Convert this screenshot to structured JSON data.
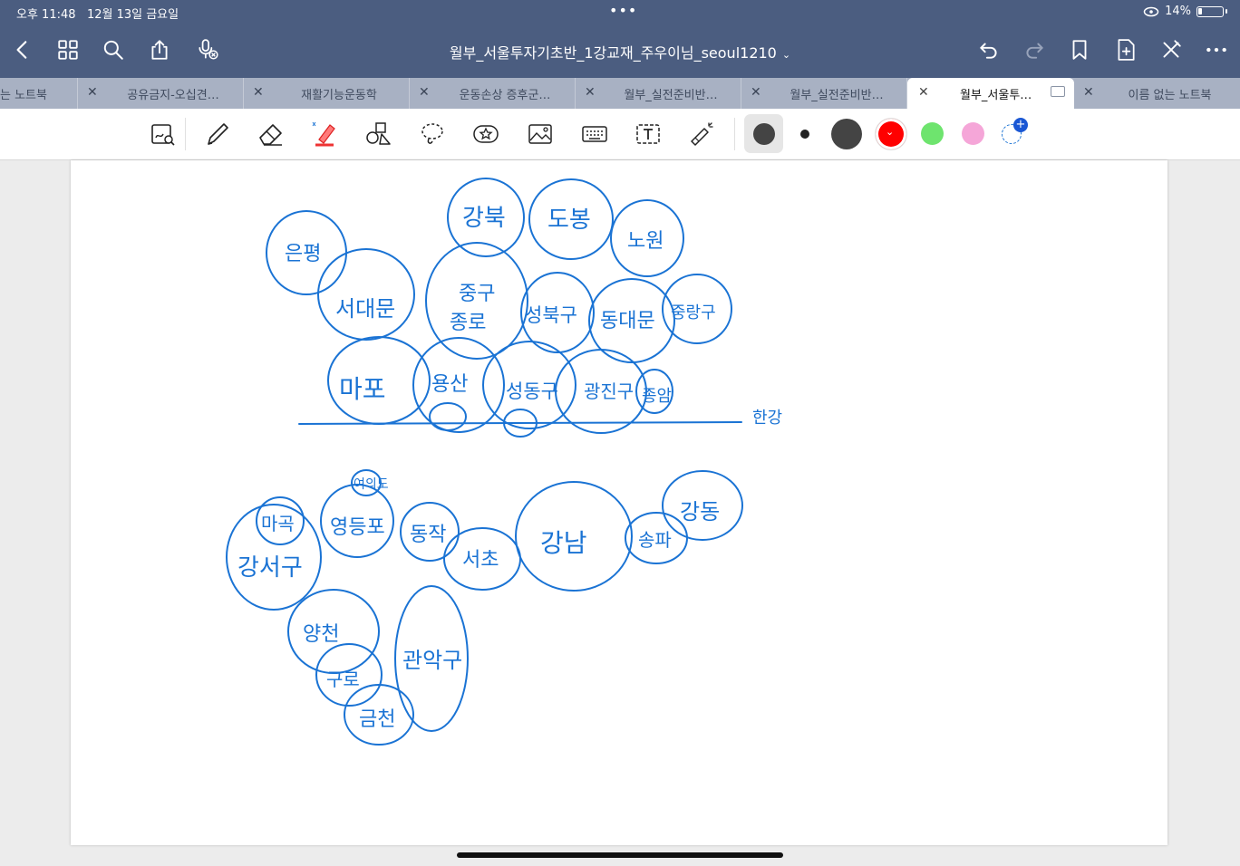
{
  "status": {
    "time": "오후 11:48",
    "date": "12월 13일 금요일",
    "multitask_dots": "•••",
    "battery": "14%"
  },
  "document": {
    "title": "월부_서울투자기초반_1강교재_주우이님_seoul1210"
  },
  "tabs": [
    {
      "label": "는 노트북",
      "active": false
    },
    {
      "label": "공유금지-오십견…",
      "active": false
    },
    {
      "label": "재활기능운동학",
      "active": false
    },
    {
      "label": "운동손상 증후군…",
      "active": false
    },
    {
      "label": "월부_실전준비반…",
      "active": false
    },
    {
      "label": "월부_실전준비반…",
      "active": false
    },
    {
      "label": "월부_서울투…",
      "active": true
    },
    {
      "label": "이름 없는 노트북",
      "active": false
    }
  ],
  "palette": {
    "header_bg": "#4b5d80",
    "ink": "#1a73d4",
    "swatches": [
      "#444444",
      "#444444",
      "#444444",
      "#ff0000",
      "#6ee46e",
      "#f5a6d8"
    ]
  },
  "handwriting": {
    "north": [
      {
        "text": "은평",
        "name": "eunpyeong"
      },
      {
        "text": "강북",
        "name": "gangbuk"
      },
      {
        "text": "도봉",
        "name": "dobong"
      },
      {
        "text": "노원",
        "name": "nowon"
      },
      {
        "text": "서대문",
        "name": "seodaemun"
      },
      {
        "text": "종로",
        "name": "jongno"
      },
      {
        "text": "중구",
        "name": "junggu"
      },
      {
        "text": "성북구",
        "name": "seongbuk"
      },
      {
        "text": "동대문",
        "name": "dongdaemun"
      },
      {
        "text": "중랑구",
        "name": "jungnang"
      },
      {
        "text": "마포",
        "name": "mapo"
      },
      {
        "text": "용산",
        "name": "yongsan"
      },
      {
        "text": "성동구",
        "name": "seongdong"
      },
      {
        "text": "광진구",
        "name": "gwangjin"
      },
      {
        "text": "종암",
        "name": "jongam"
      }
    ],
    "river_label": "한강",
    "south": [
      {
        "text": "마곡",
        "name": "magok"
      },
      {
        "text": "영등포",
        "name": "yeongdeungpo"
      },
      {
        "text": "여의도",
        "name": "yeouido"
      },
      {
        "text": "동작",
        "name": "dongjak"
      },
      {
        "text": "서초",
        "name": "seocho"
      },
      {
        "text": "강남",
        "name": "gangnam"
      },
      {
        "text": "송파",
        "name": "songpa"
      },
      {
        "text": "강동",
        "name": "gangdong"
      },
      {
        "text": "강서구",
        "name": "gangseo"
      },
      {
        "text": "양천",
        "name": "yangcheon"
      },
      {
        "text": "관악구",
        "name": "gwanak"
      },
      {
        "text": "구로",
        "name": "guro"
      },
      {
        "text": "금천",
        "name": "geumcheon"
      }
    ]
  }
}
